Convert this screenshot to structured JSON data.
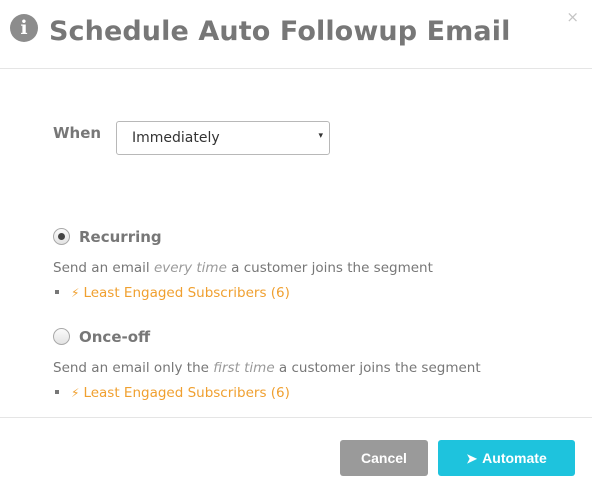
{
  "header": {
    "info_icon": "i",
    "title": "Schedule Auto Followup Email",
    "close": "×"
  },
  "when": {
    "label": "When",
    "selected": "Immediately",
    "caret": "▾"
  },
  "options": {
    "recurring": {
      "label": "Recurring",
      "checked": true,
      "desc_before": "Send an email ",
      "desc_emphasis": "every time",
      "desc_after": " a customer joins the segment",
      "segment": "Least Engaged Subscribers (6)"
    },
    "once_off": {
      "label": "Once-off",
      "checked": false,
      "desc_before": "Send an email only the ",
      "desc_emphasis": "first time",
      "desc_after": " a customer joins the segment",
      "segment": "Least Engaged Subscribers (6)"
    }
  },
  "footer": {
    "cancel_label": "Cancel",
    "automate_label": "Automate"
  },
  "icons": {
    "bolt": "⚡",
    "plane": "➤"
  },
  "colors": {
    "accent": "#1ec3dd",
    "link": "#f0a030",
    "cancel": "#9a9a9a"
  }
}
